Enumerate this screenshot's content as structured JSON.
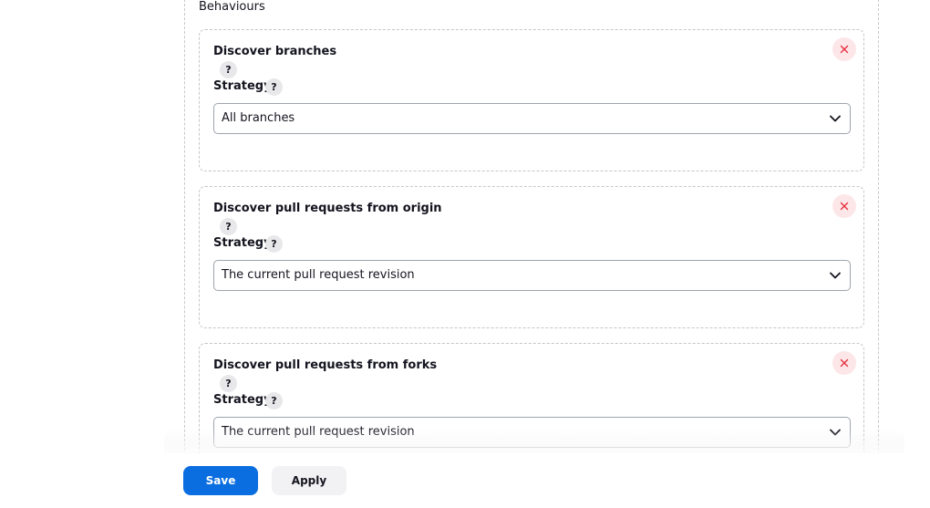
{
  "section": {
    "title": "Behaviours"
  },
  "behaviours": [
    {
      "title": "Discover branches",
      "help": "?",
      "strategy_label": "Strategy",
      "strategy_help": "?",
      "strategy_value": "All branches"
    },
    {
      "title": "Discover pull requests from origin",
      "help": "?",
      "strategy_label": "Strategy",
      "strategy_help": "?",
      "strategy_value": "The current pull request revision"
    },
    {
      "title": "Discover pull requests from forks",
      "help": "?",
      "strategy_label": "Strategy",
      "strategy_help": "?",
      "strategy_value": "The current pull request revision"
    }
  ],
  "footer": {
    "save_label": "Save",
    "apply_label": "Apply"
  },
  "colors": {
    "primary": "#0b6ee0",
    "danger": "#e5303f",
    "danger_bg": "#fde6e8"
  },
  "icons": {
    "close": "close-icon",
    "chevron": "chevron-down-icon",
    "help": "help-icon"
  }
}
